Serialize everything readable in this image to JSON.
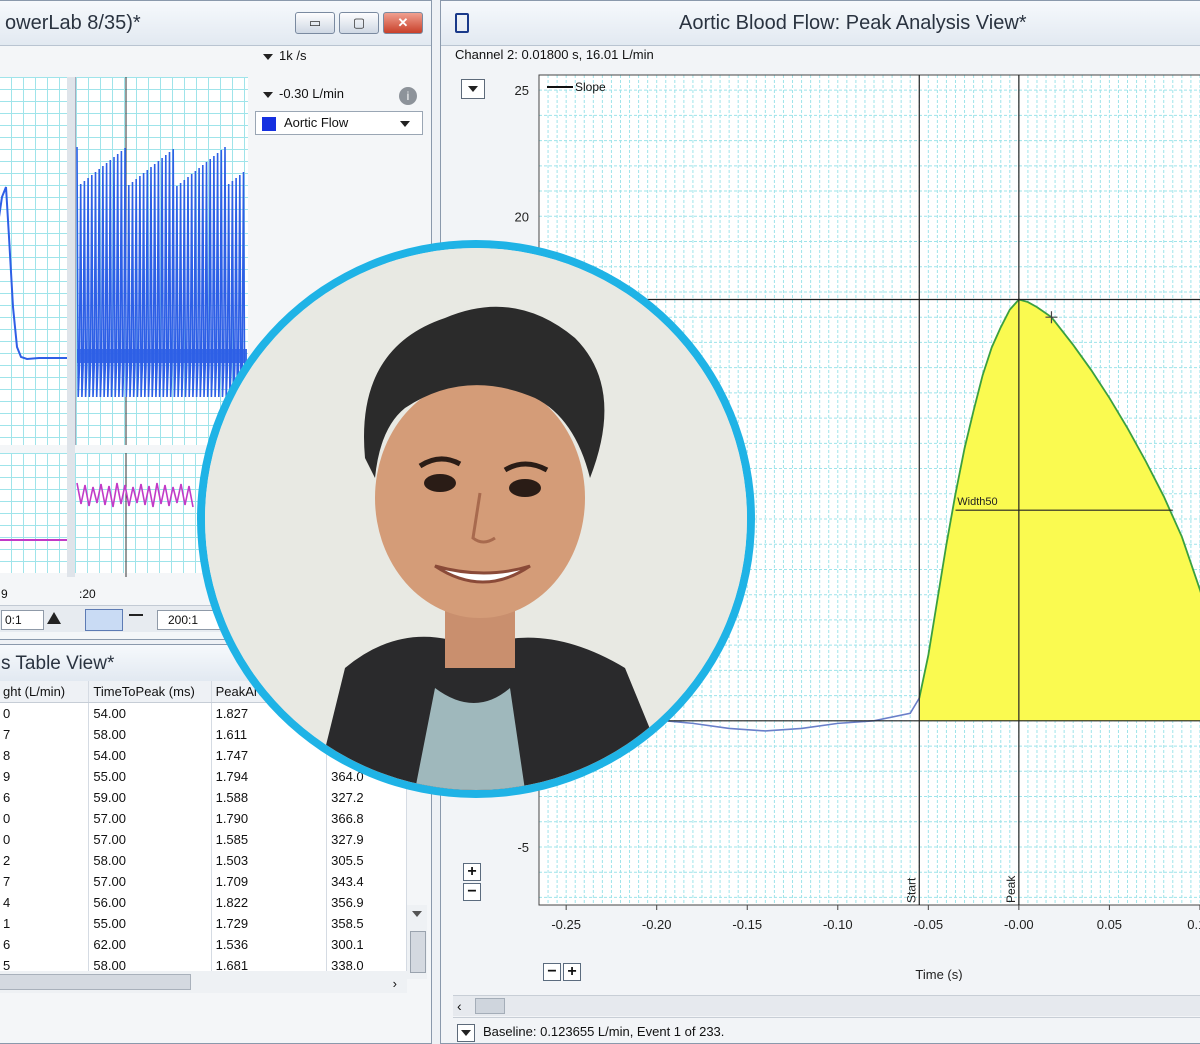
{
  "left_window": {
    "title": "owerLab 8/35)*",
    "controls": [
      "▭",
      "▢",
      "✕"
    ],
    "rate": "1k /s",
    "range_value": "-0.30 L/min",
    "channel": "Aortic Flow",
    "tick_left": "9",
    "tick_right": ":20",
    "zoom_left": "0:1",
    "zoom_right": "200:1",
    "channel_color": "#1530e0",
    "trace_color": "#2e5fe6",
    "trace2_color": "#c23ac7"
  },
  "table_view": {
    "title": "s Table View*",
    "columns": [
      "ght (L/min)",
      "TimeToPeak (ms)",
      "PeakAre",
      ""
    ],
    "rows": [
      [
        "0",
        "54.00",
        "1.827",
        ""
      ],
      [
        "7",
        "58.00",
        "1.611",
        ""
      ],
      [
        "8",
        "54.00",
        "1.747",
        ""
      ],
      [
        "9",
        "55.00",
        "1.794",
        "364.0"
      ],
      [
        "6",
        "59.00",
        "1.588",
        "327.2"
      ],
      [
        "0",
        "57.00",
        "1.790",
        "366.8"
      ],
      [
        "0",
        "57.00",
        "1.585",
        "327.9"
      ],
      [
        "2",
        "58.00",
        "1.503",
        "305.5"
      ],
      [
        "7",
        "57.00",
        "1.709",
        "343.4"
      ],
      [
        "4",
        "56.00",
        "1.822",
        "356.9"
      ],
      [
        "1",
        "55.00",
        "1.729",
        "358.5"
      ],
      [
        "6",
        "62.00",
        "1.536",
        "300.1"
      ],
      [
        "5",
        "58.00",
        "1.681",
        "338.0"
      ]
    ]
  },
  "peak_window": {
    "title": "Aortic Blood Flow: Peak Analysis View*",
    "channel_readout": "Channel 2: 0.01800 s, 16.01 L/min",
    "legend": "Slope",
    "width_label": "Width50",
    "start_label": "Start",
    "peak_label": "Peak",
    "status": "Baseline: 0.123655 L/min, Event 1 of 233.",
    "fill_color": "#fafa50",
    "curve_color": "#3aa040"
  },
  "chart_data": {
    "type": "area",
    "xlabel": "Time (s)",
    "x_ticks": [
      "-0.25",
      "-0.20",
      "-0.15",
      "-0.10",
      "-0.05",
      "-0.00",
      "0.05",
      "0.10"
    ],
    "y_ticks": [
      "25",
      "20",
      "-5"
    ],
    "xlim": [
      -0.265,
      0.105
    ],
    "ylim": [
      -7.3,
      25.6
    ],
    "x": [
      -0.265,
      -0.24,
      -0.21,
      -0.18,
      -0.16,
      -0.14,
      -0.12,
      -0.1,
      -0.08,
      -0.06,
      -0.055,
      -0.05,
      -0.045,
      -0.04,
      -0.035,
      -0.03,
      -0.025,
      -0.02,
      -0.015,
      -0.01,
      -0.005,
      0.0,
      0.005,
      0.01,
      0.018,
      0.03,
      0.04,
      0.05,
      0.06,
      0.07,
      0.08,
      0.09,
      0.1,
      0.105
    ],
    "y": [
      0.3,
      0.4,
      0.1,
      -0.1,
      -0.3,
      -0.4,
      -0.3,
      -0.1,
      0.0,
      0.3,
      0.9,
      2.6,
      4.8,
      7.0,
      9.0,
      10.8,
      12.3,
      13.7,
      14.8,
      15.6,
      16.3,
      16.7,
      16.6,
      16.4,
      16.0,
      14.9,
      13.9,
      12.8,
      11.6,
      10.3,
      8.9,
      7.3,
      5.2,
      4.0
    ],
    "cursor_x": [
      -0.055,
      0.0
    ],
    "baseline": 0.0,
    "width50_level": 8.35,
    "peak_level": 16.7,
    "grid": true,
    "legend_position": "top-left"
  }
}
